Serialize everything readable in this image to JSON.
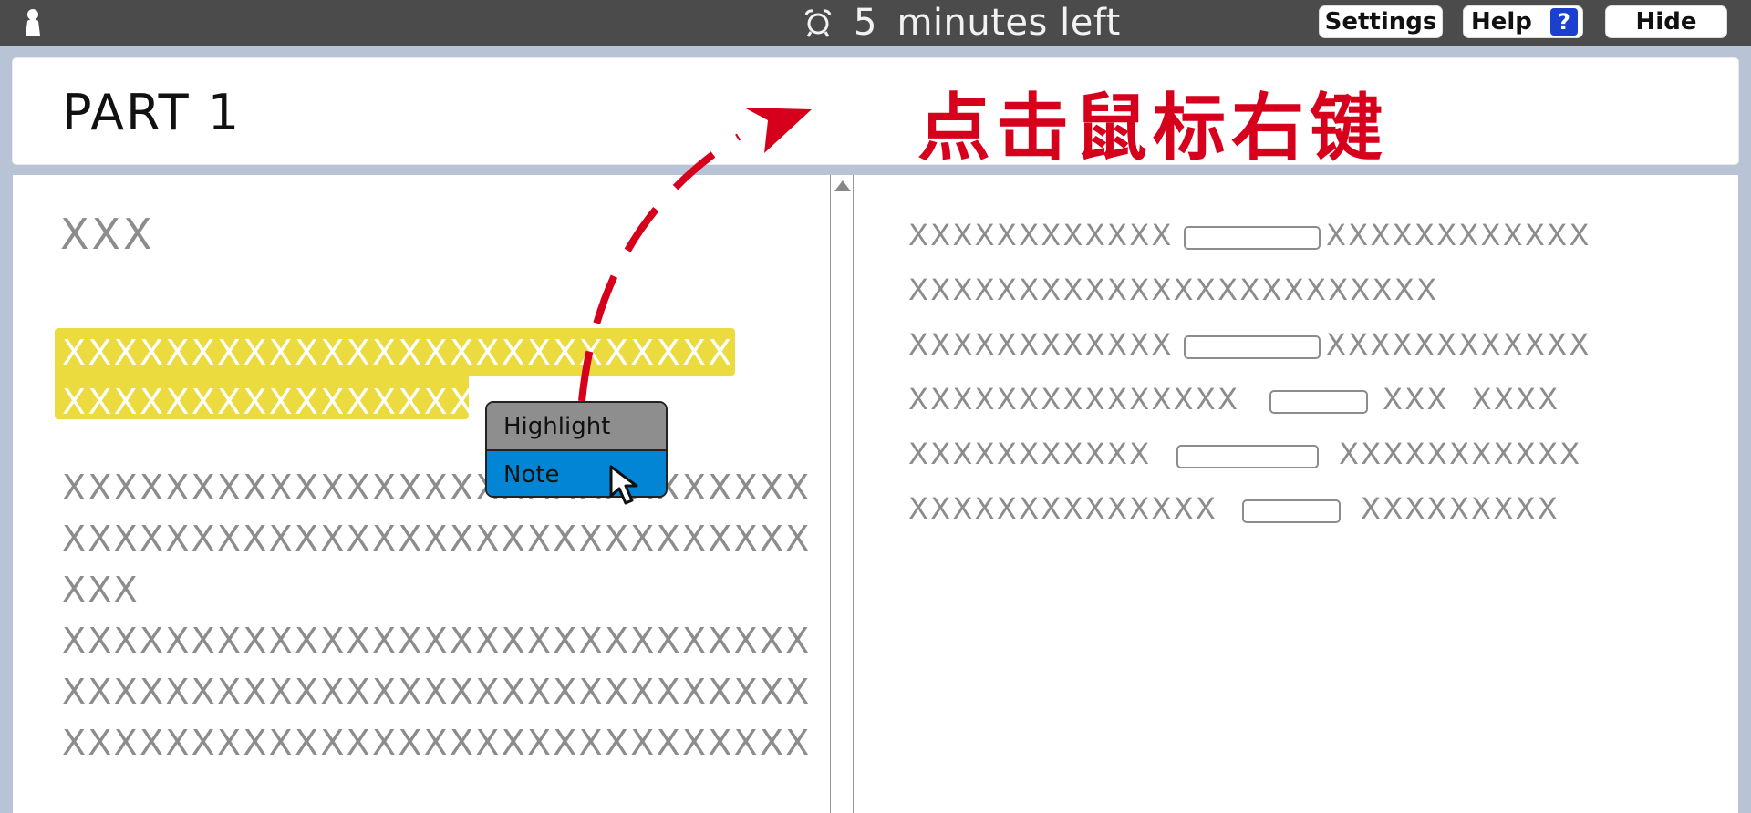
{
  "topbar": {
    "timer_value": "5",
    "timer_label": "minutes left",
    "settings_label": "Settings",
    "help_label": "Help",
    "help_icon_glyph": "?",
    "hide_label": "Hide",
    "icons": {
      "user": "user-icon",
      "alarm": "alarm-clock-icon",
      "help": "question-icon"
    }
  },
  "banner": {
    "title": "PART 1",
    "annotation": "点击鼠标右键"
  },
  "left_panel": {
    "heading": "XXX",
    "highlighted_lines": [
      "XXXXXXXXXXXXXXXXXXXXXXXXXXXXX",
      "XXXXXXXXXXXXXXXXX"
    ],
    "body_lines": [
      "XXXXXXXXXXXXXXXXXXXXXXXXXXXXX",
      "XXXXXXXXXXXXXXXXXXXXXXXXXXXXX",
      "XXX",
      "XXXXXXXXXXXXXXXXXXXXXXXXXXXXX",
      "XXXXXXXXXXXXXXXXXXXXXXXXXXXXX",
      "XXXXXXXXXXXXXXXXXXXXXXXXXXXXX"
    ],
    "highlight_color": "#ebdb3e"
  },
  "context_menu": {
    "items": [
      {
        "label": "Highlight",
        "selected": false
      },
      {
        "label": "Note",
        "selected": true
      }
    ],
    "highlight_bg": "#8e8e8e",
    "selected_bg": "#0385d6"
  },
  "right_panel": {
    "lines": [
      {
        "before": "XXXXXXXXXXXX",
        "after": "XXXXXXXXXXXX"
      },
      {
        "before": "XXXXXXXXXXXXXXXXXXXXXXXX",
        "after": null
      },
      {
        "before": "XXXXXXXXXXXX",
        "after": "XXXXXXXXXXXX"
      },
      {
        "before": "XXXXXXXXXXXXXXX",
        "after": "XXX  XXXX"
      },
      {
        "before": "XXXXXXXXXXX",
        "after": "XXXXXXXXXXX"
      },
      {
        "before": "XXXXXXXXXXXXXX",
        "after": "XXXXXXXXX"
      }
    ]
  },
  "colors": {
    "topbar": "#4b4b4b",
    "frame": "#b8c3d6",
    "annotation": "#d6001c",
    "help_badge": "#1b3fcf"
  }
}
